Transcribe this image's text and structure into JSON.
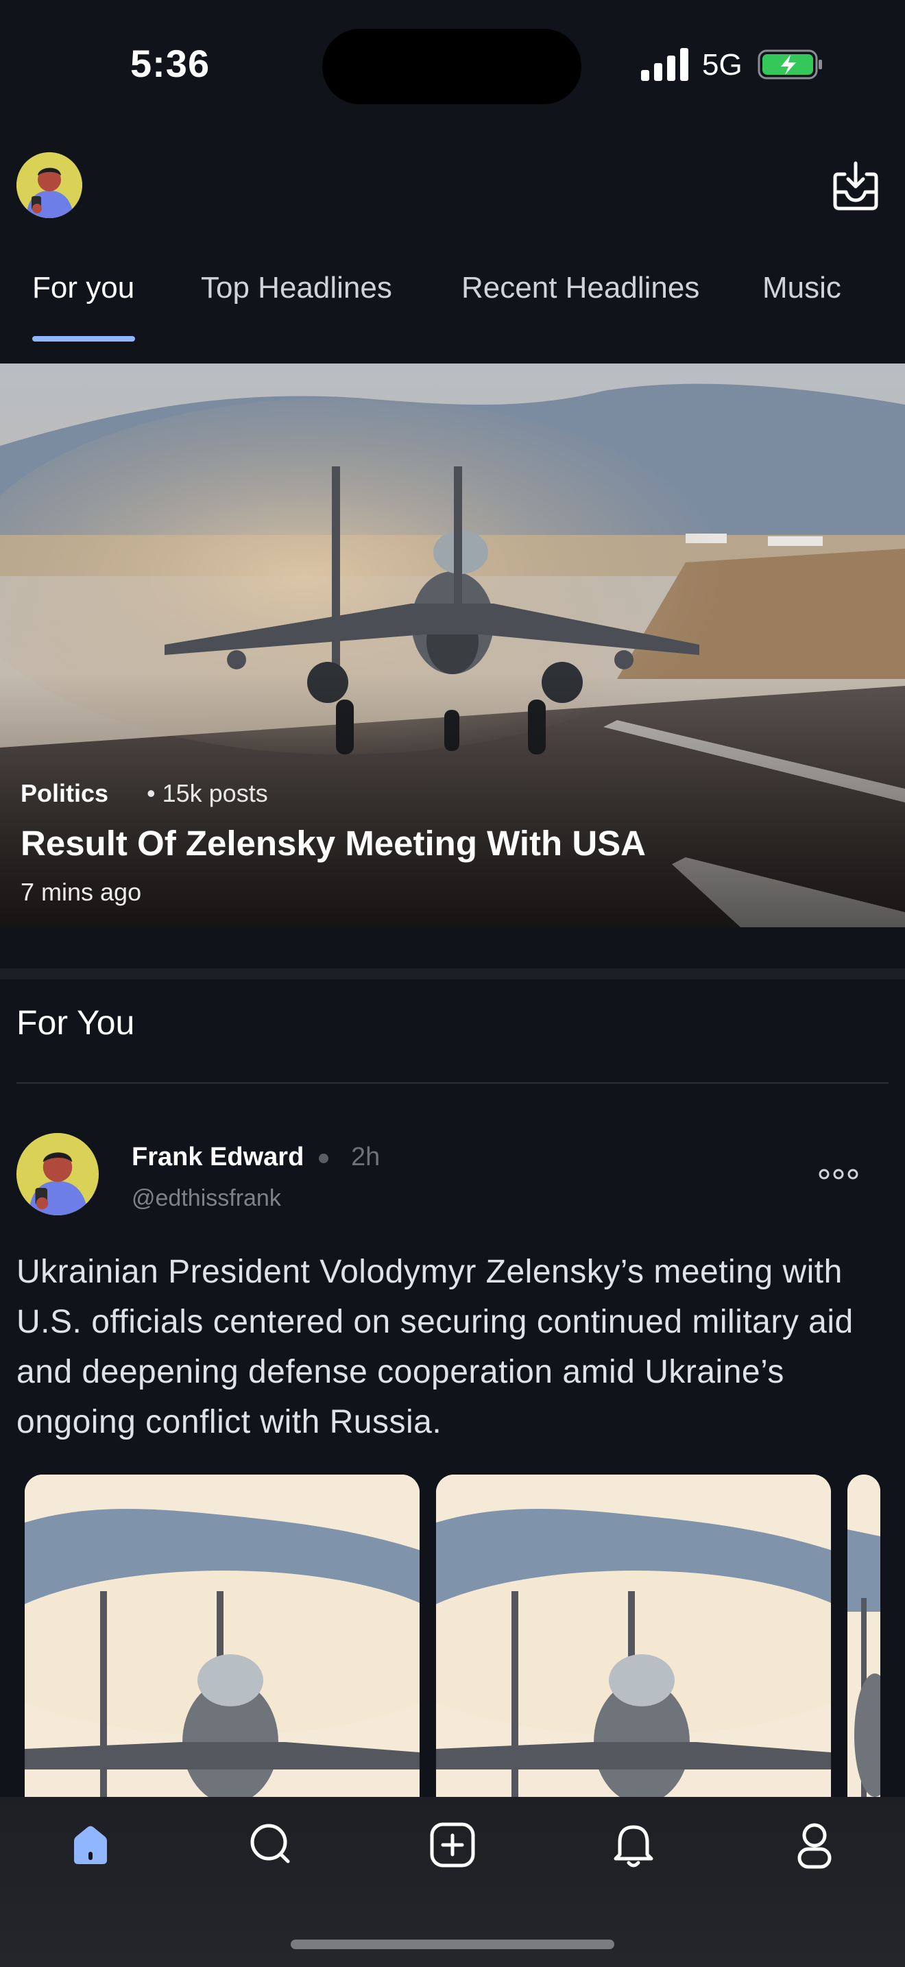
{
  "status_bar": {
    "time": "5:36",
    "network": "5G"
  },
  "tabs": [
    {
      "label": "For you",
      "active": true
    },
    {
      "label": "Top Headlines",
      "active": false
    },
    {
      "label": "Recent Headlines",
      "active": false
    },
    {
      "label": "Music",
      "active": false
    }
  ],
  "hero": {
    "category": "Politics",
    "posts": "• 15k posts",
    "title": "Result Of Zelensky Meeting With USA",
    "time": "7 mins ago"
  },
  "section": {
    "title": "For You"
  },
  "post": {
    "name": "Frank Edward",
    "time": "2h",
    "handle": "@edthissfrank",
    "body": "Ukrainian President Volodymyr Zelensky’s meeting with U.S. officials centered on securing continued military aid and deepening defense cooperation amid Ukraine’s ongoing conflict with Russia."
  },
  "nav": [
    "home-icon",
    "search-icon",
    "add-icon",
    "bell-icon",
    "profile-icon"
  ],
  "colors": {
    "background": "#10131a",
    "accent": "#8fb6ff",
    "battery": "#34c759"
  }
}
